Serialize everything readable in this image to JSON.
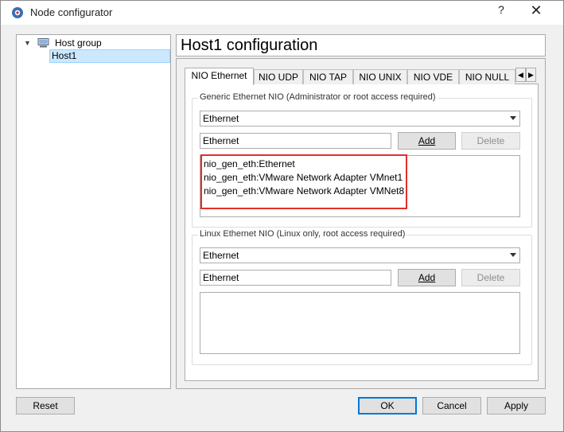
{
  "window": {
    "title": "Node configurator",
    "help_glyph": "?",
    "close_glyph": "✕"
  },
  "tree": {
    "group_label": "Host group",
    "host_label": "Host1"
  },
  "config": {
    "title": "Host1 configuration",
    "tabs": [
      {
        "label": "NIO Ethernet"
      },
      {
        "label": "NIO UDP"
      },
      {
        "label": "NIO TAP"
      },
      {
        "label": "NIO UNIX"
      },
      {
        "label": "NIO VDE"
      },
      {
        "label": "NIO NULL"
      }
    ],
    "generic": {
      "legend": "Generic Ethernet NIO (Administrator or root access required)",
      "combo_value": "Ethernet",
      "input_value": "Ethernet",
      "add_label": "Add",
      "delete_label": "Delete",
      "items": [
        "nio_gen_eth:Ethernet",
        "nio_gen_eth:VMware Network Adapter VMnet1",
        "nio_gen_eth:VMware Network Adapter VMNet8"
      ]
    },
    "linux": {
      "legend": "Linux Ethernet NIO (Linux only, root access required)",
      "combo_value": "Ethernet",
      "input_value": "Ethernet",
      "add_label": "Add",
      "delete_label": "Delete"
    }
  },
  "buttons": {
    "reset": "Reset",
    "ok": "OK",
    "cancel": "Cancel",
    "apply": "Apply"
  },
  "colors": {
    "highlight": "#e0302a",
    "selection": "#cce8ff",
    "default_button_border": "#0078d7"
  }
}
